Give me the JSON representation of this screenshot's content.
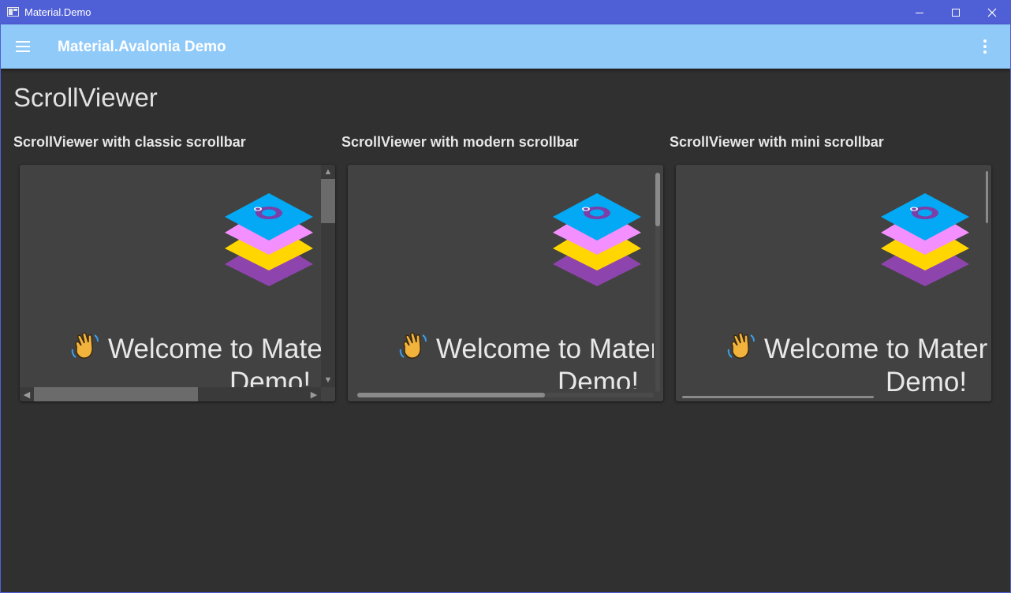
{
  "window": {
    "title": "Material.Demo",
    "controls": {
      "minimize": "minimize-icon",
      "maximize": "maximize-icon",
      "close": "close-icon"
    }
  },
  "appbar": {
    "title": "Material.Avalonia Demo",
    "menu_icon": "hamburger-menu-icon",
    "more_icon": "more-vertical-icon",
    "color": "#90caf9"
  },
  "page": {
    "title": "ScrollViewer",
    "sections": [
      {
        "label": "ScrollViewer with classic scrollbar",
        "welcome_line1": "Welcome to Mater",
        "welcome_line2": "Demo!",
        "scrollbar_style": "classic"
      },
      {
        "label": "ScrollViewer with modern scrollbar",
        "welcome_line1": "Welcome to Materi",
        "welcome_line2": "Demo!",
        "scrollbar_style": "modern"
      },
      {
        "label": "ScrollViewer with mini scrollbar",
        "welcome_line1": "Welcome to Materi",
        "welcome_line2": "Demo!",
        "scrollbar_style": "mini"
      }
    ]
  },
  "colors": {
    "titlebar": "#4f5fd6",
    "background": "#303030",
    "card": "#424242",
    "logo_layers": [
      "#8e44ad",
      "#ffd600",
      "#f48fff",
      "#03a9f4"
    ]
  }
}
